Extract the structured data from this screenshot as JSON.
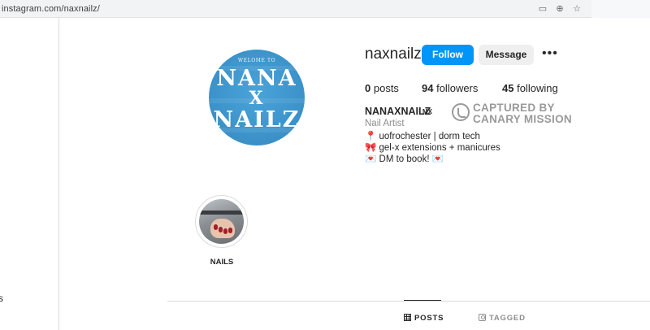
{
  "browser": {
    "url": "instagram.com/naxnailz/",
    "icons": [
      "screen-share-icon",
      "zoom-icon",
      "star-icon"
    ]
  },
  "sidebar": {
    "fragment": "s"
  },
  "profile": {
    "avatar_text": {
      "welcome": "WELOME TO",
      "line1": "NANA",
      "line2": "X",
      "line3": "NAILZ"
    },
    "username": "naxnailz",
    "follow_label": "Follow",
    "message_label": "Message",
    "more_label": "•••",
    "stats": {
      "posts_count": "0",
      "posts_label": "posts",
      "followers_count": "94",
      "followers_label": "followers",
      "following_count": "45",
      "following_label": "following"
    },
    "bio": {
      "name": "NANAXNAILZ",
      "pronoun": "MX",
      "category": "Nail Artist",
      "lines": [
        "📍 uofrochester | dorm tech",
        "🎀 gel-x extensions + manicures",
        "💌 DM to book! 💌"
      ]
    }
  },
  "watermark": {
    "line1": "CAPTURED BY",
    "line2": "CANARY MISSION"
  },
  "highlights": [
    {
      "label": "NAILS"
    }
  ],
  "tabs": [
    {
      "label": "POSTS",
      "icon": "grid-icon",
      "active": true
    },
    {
      "label": "TAGGED",
      "icon": "tag-icon",
      "active": false
    }
  ],
  "colors": {
    "follow_button": "#0095f6",
    "message_button": "#efefef",
    "avatar_blue": "#3d95cc",
    "muted_text": "#8e8e8e"
  }
}
